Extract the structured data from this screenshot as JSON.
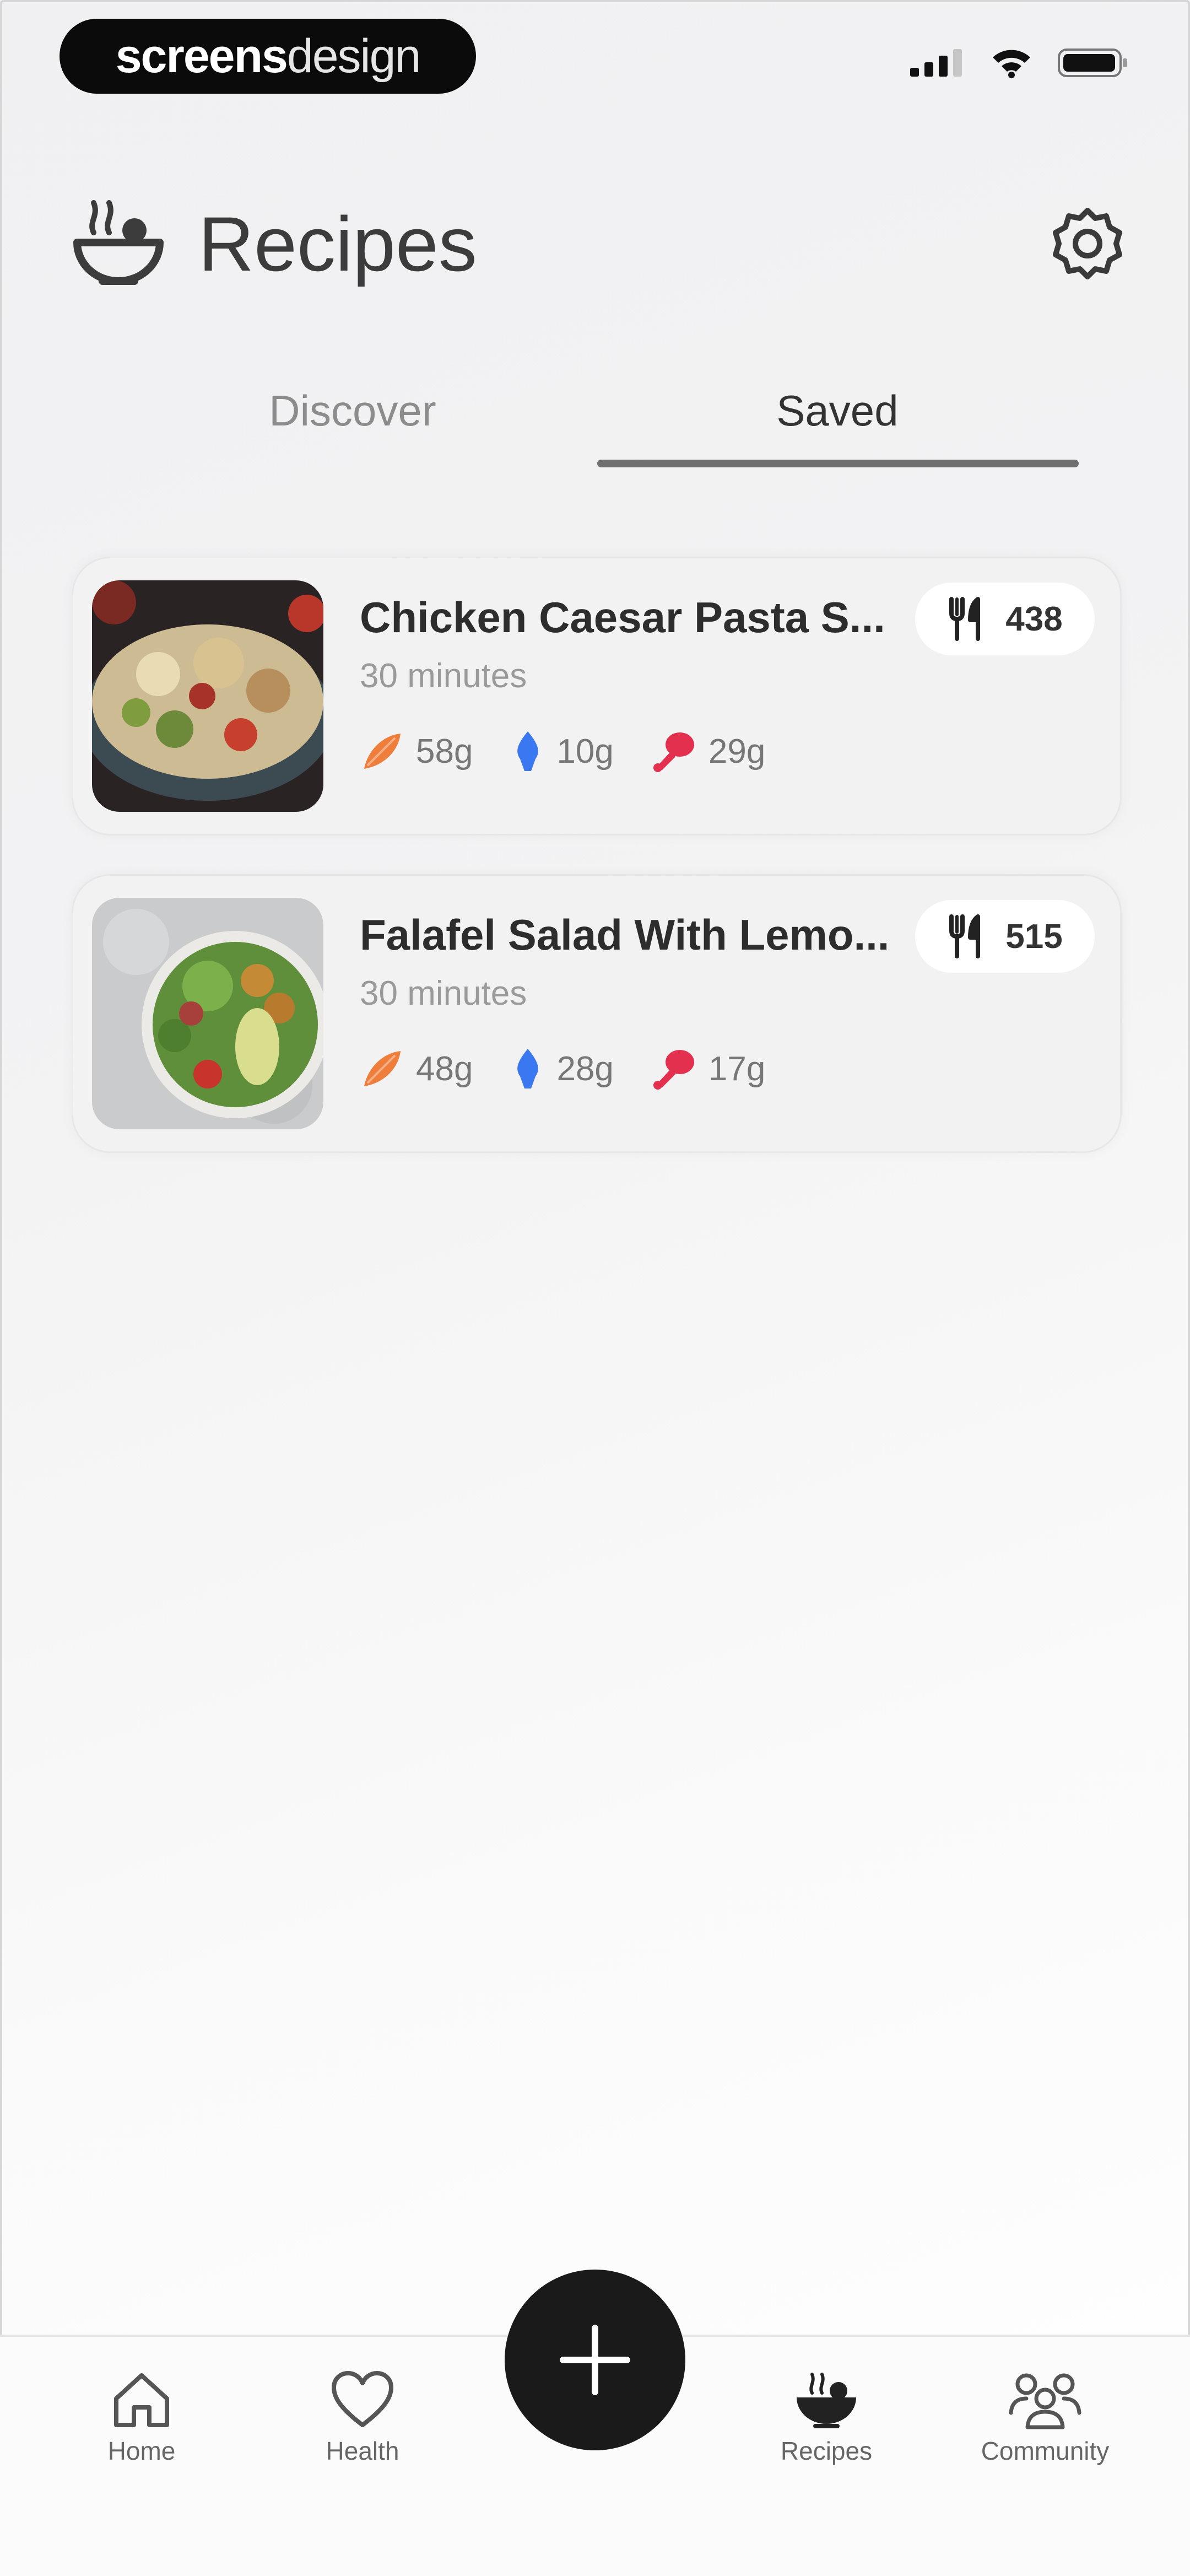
{
  "status_bar": {
    "brand_bold": "screens",
    "brand_light": "design",
    "icons": [
      "cellular-signal-icon",
      "wifi-icon",
      "battery-icon"
    ]
  },
  "header": {
    "app_icon": "bowl-icon",
    "title": "Recipes",
    "settings_icon": "gear-icon"
  },
  "tabs": [
    {
      "label": "Discover",
      "active": false
    },
    {
      "label": "Saved",
      "active": true
    }
  ],
  "recipes": [
    {
      "title": "Chicken Caesar Pasta S...",
      "time": "30 minutes",
      "kcal": "438",
      "macros": {
        "carbs": "58g",
        "fat": "10g",
        "protein": "29g"
      }
    },
    {
      "title": "Falafel Salad With Lemo...",
      "time": "30 minutes",
      "kcal": "515",
      "macros": {
        "carbs": "48g",
        "fat": "28g",
        "protein": "17g"
      }
    }
  ],
  "macro_colors": {
    "carbs": "#ef7d3c",
    "fat": "#3a78f2",
    "protein": "#e4304f"
  },
  "bottom_nav": {
    "items": [
      {
        "label": "Home",
        "icon": "home-icon"
      },
      {
        "label": "Health",
        "icon": "heart-icon"
      },
      {
        "label": "Recipes",
        "icon": "bowl-icon",
        "active": true
      },
      {
        "label": "Community",
        "icon": "community-icon"
      }
    ],
    "fab_icon": "plus-icon"
  }
}
